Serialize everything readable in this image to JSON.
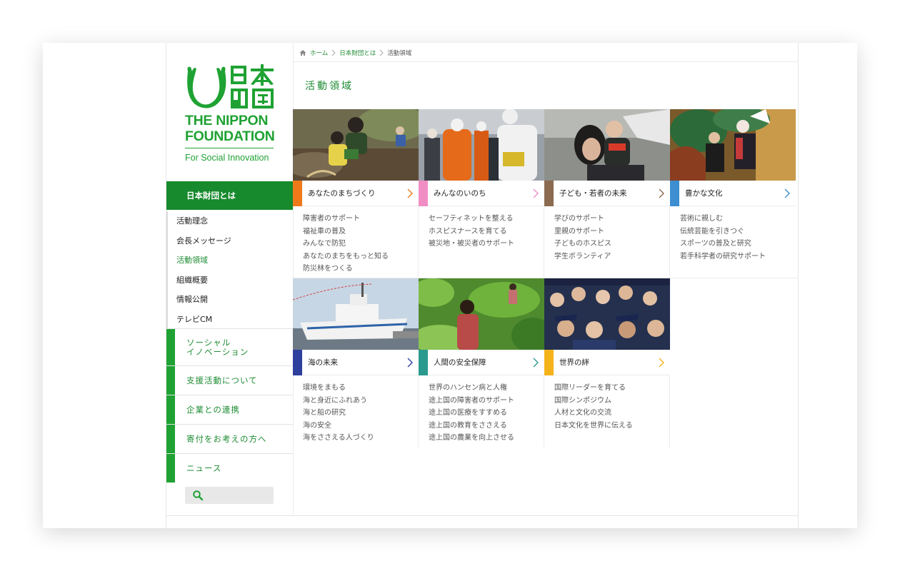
{
  "logo": {
    "line1": "THE NIPPON",
    "line2": "FOUNDATION",
    "tagline": "For Social Innovation",
    "brand_color": "#1fa233"
  },
  "breadcrumb": {
    "home": "ホーム",
    "parent": "日本財団とは",
    "current": "活動領域"
  },
  "page_title": "活動領域",
  "sidebar": {
    "section_head": "日本財団とは",
    "subnav": [
      "活動理念",
      "会長メッセージ",
      "活動領域",
      "組織概要",
      "情報公開",
      "テレビCM"
    ],
    "mainnav": [
      {
        "line1": "ソーシャル",
        "line2": "イノベーション"
      },
      {
        "line1": "支援活動について"
      },
      {
        "line1": "企業との連携"
      },
      {
        "line1": "寄付をお考えの方へ"
      },
      {
        "line1": "ニュース"
      }
    ]
  },
  "areas": [
    {
      "title": "あなたのまちづくり",
      "color": "#f07a1a",
      "photo": "community-photo",
      "links": [
        "障害者のサポート",
        "福祉車の普及",
        "みんなで防犯",
        "あなたのまちをもっと知る",
        "防災林をつくる"
      ]
    },
    {
      "title": "みんなのいのち",
      "color": "#f08ec4",
      "photo": "relief-workers-photo",
      "links": [
        "セーフティネットを整える",
        "ホスピスナースを育てる",
        "被災地・被災者のサポート"
      ]
    },
    {
      "title": "子ども・若者の未来",
      "color": "#8b6a4f",
      "photo": "mother-child-photo",
      "links": [
        "学びのサポート",
        "里親のサポート",
        "子どものホスピス",
        "学生ボランティア"
      ]
    },
    {
      "title": "豊かな文化",
      "color": "#3d8fd1",
      "photo": "traditional-arts-photo",
      "links": [
        "芸術に親しむ",
        "伝統芸能を引きつぐ",
        "スポーツの普及と研究",
        "若手科学者の研究サポート"
      ]
    },
    {
      "title": "海の未来",
      "color": "#2e3f9e",
      "photo": "patrol-ship-photo",
      "links": [
        "環境をまもる",
        "海と身近にふれあう",
        "海と船の研究",
        "海の安全",
        "海をささえる人づくり"
      ]
    },
    {
      "title": "人間の安全保障",
      "color": "#2a9a8e",
      "photo": "farm-field-photo",
      "links": [
        "世界のハンセン病と人権",
        "途上国の障害者のサポート",
        "途上国の医療をすすめる",
        "途上国の教育をささえる",
        "途上国の農業を向上させる"
      ]
    },
    {
      "title": "世界の絆",
      "color": "#f5b31b",
      "photo": "graduates-photo",
      "links": [
        "国際リーダーを育てる",
        "国際シンポジウム",
        "人材と文化の交流",
        "日本文化を世界に伝える"
      ]
    }
  ]
}
